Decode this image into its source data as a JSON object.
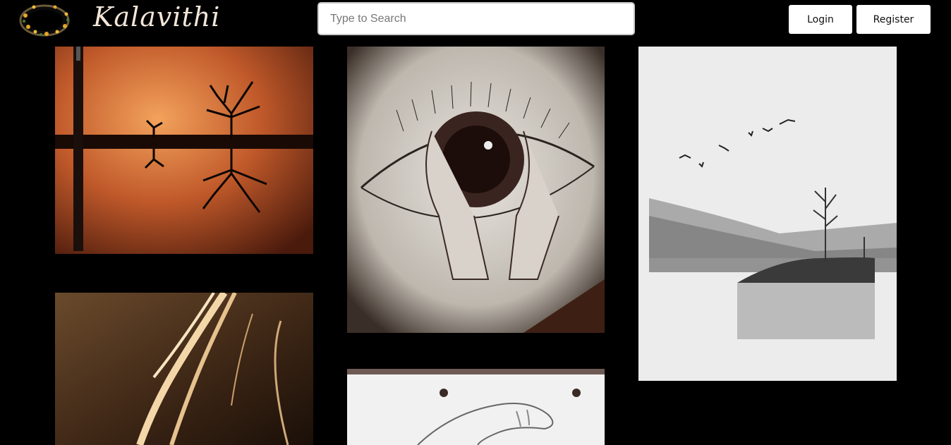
{
  "header": {
    "brand_name": "Kalavithi",
    "search_placeholder": "Type to Search",
    "login_label": "Login",
    "register_label": "Register"
  },
  "gallery": {
    "items": [
      {
        "subject": "tree-reflection-painting"
      },
      {
        "subject": "eye-with-hands-drawing"
      },
      {
        "subject": "misty-lake-landscape-painting"
      },
      {
        "subject": "woman-hair-light-painting"
      },
      {
        "subject": "hand-pencil-sketch"
      }
    ]
  }
}
